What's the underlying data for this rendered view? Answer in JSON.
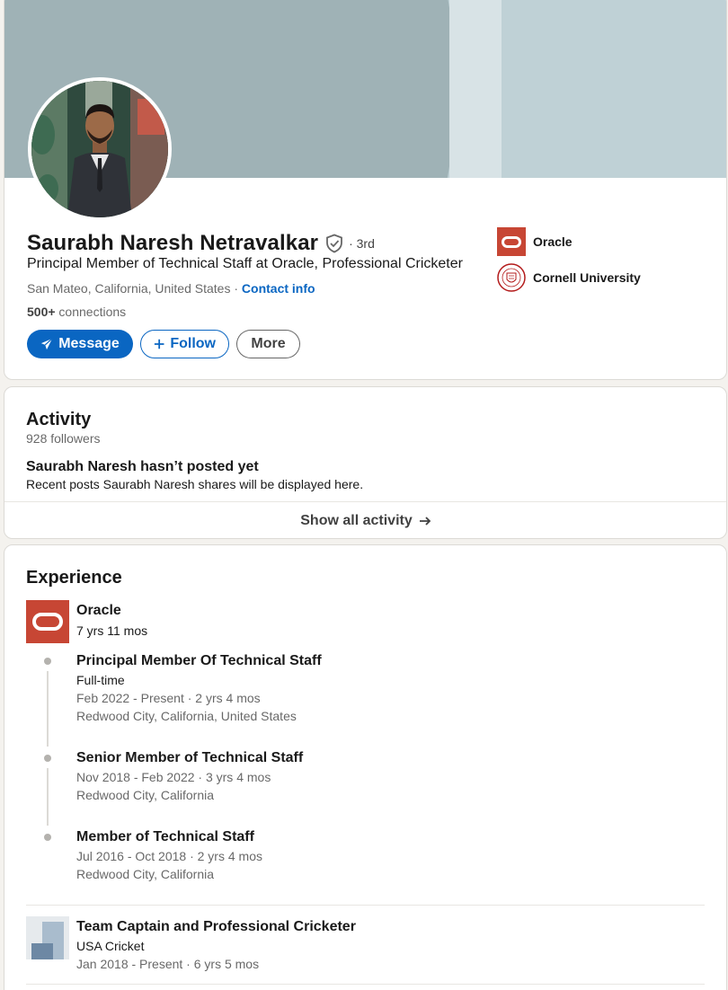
{
  "profile": {
    "name": "Saurabh Naresh Netravalkar",
    "degree": "· 3rd",
    "headline": "Principal Member of Technical Staff at Oracle, Professional Cricketer",
    "location": "San Mateo, California, United States",
    "separator": " · ",
    "contact_label": "Contact info",
    "connections_count": "500+",
    "connections_label": " connections"
  },
  "actions": {
    "message": "Message",
    "follow": "Follow",
    "more": "More"
  },
  "side_links": [
    {
      "label": "Oracle",
      "icon": "oracle-logo"
    },
    {
      "label": "Cornell University",
      "icon": "cornell-seal"
    }
  ],
  "activity": {
    "title": "Activity",
    "followers": "928 followers",
    "empty_title": "Saurabh Naresh hasn’t posted yet",
    "empty_desc": "Recent posts Saurabh Naresh shares will be displayed here.",
    "show_all": "Show all activity"
  },
  "experience": {
    "title": "Experience",
    "oracle": {
      "company": "Oracle",
      "duration": "7 yrs 11 mos",
      "roles": [
        {
          "title": "Principal Member Of Technical Staff",
          "type": "Full-time",
          "dates": "Feb 2022 - Present · 2 yrs 4 mos",
          "location": "Redwood City, California, United States"
        },
        {
          "title": "Senior Member of Technical Staff",
          "dates": "Nov 2018 - Feb 2022 · 3 yrs 4 mos",
          "location": "Redwood City, California"
        },
        {
          "title": "Member of Technical Staff",
          "dates": "Jul 2016 - Oct 2018 · 2 yrs 4 mos",
          "location": "Redwood City, California"
        }
      ]
    },
    "cricket": {
      "title": "Team Captain and Professional Cricketer",
      "org": "USA Cricket",
      "dates": "Jan 2018 - Present · 6 yrs 5 mos"
    }
  },
  "colors": {
    "brand_blue": "#0a66c2",
    "oracle_red": "#c74634",
    "banner": "#bfd1d6"
  }
}
